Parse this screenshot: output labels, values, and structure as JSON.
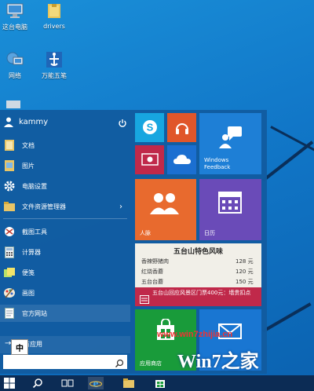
{
  "desktop": {
    "icons": [
      {
        "label": "这台电脑",
        "icon": "computer-icon"
      },
      {
        "label": "drivers",
        "icon": "folder-icon"
      },
      {
        "label": "网络",
        "icon": "network-icon"
      },
      {
        "label": "万能五笔",
        "icon": "wubi-icon"
      }
    ]
  },
  "start_menu": {
    "user_name": "kammy",
    "items": [
      {
        "label": "文档",
        "icon": "documents-icon"
      },
      {
        "label": "图片",
        "icon": "pictures-icon"
      },
      {
        "label": "电脑设置",
        "icon": "settings-gear-icon"
      },
      {
        "label": "文件资源管理器",
        "icon": "file-explorer-icon",
        "has_submenu": true
      },
      {
        "label": "截图工具",
        "icon": "snipping-tool-icon"
      },
      {
        "label": "计算器",
        "icon": "calculator-icon"
      },
      {
        "label": "便笺",
        "icon": "sticky-notes-icon"
      },
      {
        "label": "画图",
        "icon": "paint-icon"
      },
      {
        "label": "官方网站",
        "icon": "web-icon"
      }
    ],
    "all_apps_label": "所有应用",
    "search_placeholder": ""
  },
  "tiles": {
    "windows_feedback": "Windows\nFeedback",
    "people": "人脉",
    "calendar": "日历",
    "store": "应用商店",
    "ad": {
      "title": "五台山特色风味",
      "rows": [
        {
          "name": "香辣野猪肉",
          "price": "128 元"
        },
        {
          "name": "红烧香蘑",
          "price": "120 元"
        },
        {
          "name": "五台台蘑",
          "price": "150 元"
        }
      ],
      "banner": "五台山回应风景区门票400元：墙贵扣点"
    }
  },
  "watermark": {
    "url": "www.win7zhijia.cn",
    "logo_text": "Win7之家"
  },
  "taskbar": {
    "ime_label": "中",
    "items": [
      "start-button",
      "search",
      "task-view",
      "internet-explorer",
      "file-explorer",
      "store"
    ]
  },
  "colors": {
    "start_bg": "#125ca0",
    "skype": "#17a6e0",
    "music": "#e0562a",
    "video": "#c0294a",
    "onedrive": "#1b6fd1",
    "feedback": "#1e7fd6",
    "people": "#e86a2e",
    "calendar": "#6a4bb8",
    "store": "#199b3a",
    "mail": "#1976d2"
  }
}
